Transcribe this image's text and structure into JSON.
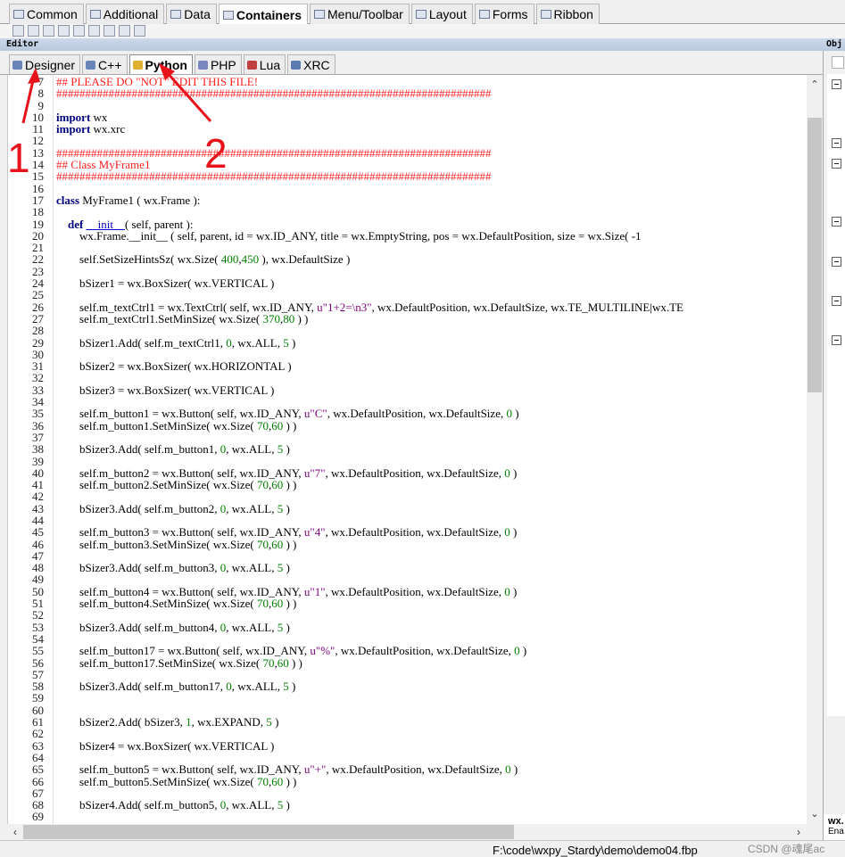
{
  "palette_tabs": [
    {
      "label": "Common",
      "icon": "common-icon",
      "active": false
    },
    {
      "label": "Additional",
      "icon": "additional-icon",
      "active": false
    },
    {
      "label": "Data",
      "icon": "data-icon",
      "active": false
    },
    {
      "label": "Containers",
      "icon": "containers-icon",
      "active": true
    },
    {
      "label": "Menu/Toolbar",
      "icon": "menu-toolbar-icon",
      "active": false
    },
    {
      "label": "Layout",
      "icon": "layout-icon",
      "active": false
    },
    {
      "label": "Forms",
      "icon": "forms-icon",
      "active": false
    },
    {
      "label": "Ribbon",
      "icon": "ribbon-icon",
      "active": false
    }
  ],
  "editor": {
    "title": "Editor",
    "tabs": [
      {
        "label": "Designer",
        "icon": "designer-icon",
        "active": false,
        "color": "#6a86b8"
      },
      {
        "label": "C++",
        "icon": "cpp-icon",
        "active": false,
        "color": "#6a86b8"
      },
      {
        "label": "Python",
        "icon": "python-icon",
        "active": true,
        "color": "#e0b030"
      },
      {
        "label": "PHP",
        "icon": "php-icon",
        "active": false,
        "color": "#7a86c0"
      },
      {
        "label": "Lua",
        "icon": "lua-icon",
        "active": false,
        "color": "#c04040"
      },
      {
        "label": "XRC",
        "icon": "xrc-icon",
        "active": false,
        "color": "#5a7ab0"
      }
    ]
  },
  "object_panel": {
    "title": "Obj",
    "bottom_title": "wx.",
    "bottom_sub": "Ena"
  },
  "code": [
    {
      "n": "7",
      "t": [
        [
          "cm",
          "## PLEASE DO \"NOT\" EDIT THIS FILE!"
        ]
      ]
    },
    {
      "n": "8",
      "t": [
        [
          "cm",
          "###########################################################################"
        ]
      ]
    },
    {
      "n": "9",
      "t": []
    },
    {
      "n": "10",
      "t": [
        [
          "kw",
          "import"
        ],
        [
          "",
          " wx"
        ]
      ]
    },
    {
      "n": "11",
      "t": [
        [
          "kw",
          "import"
        ],
        [
          "",
          " wx.xrc"
        ]
      ]
    },
    {
      "n": "12",
      "t": []
    },
    {
      "n": "13",
      "t": [
        [
          "cm",
          "###########################################################################"
        ]
      ]
    },
    {
      "n": "14",
      "t": [
        [
          "cm",
          "## Class MyFrame1"
        ]
      ]
    },
    {
      "n": "15",
      "t": [
        [
          "cm",
          "###########################################################################"
        ]
      ]
    },
    {
      "n": "16",
      "t": []
    },
    {
      "n": "17",
      "t": [
        [
          "kw",
          "class"
        ],
        [
          "",
          " MyFrame1 ( wx.Frame ):"
        ]
      ]
    },
    {
      "n": "18",
      "t": []
    },
    {
      "n": "19",
      "t": [
        [
          "",
          "    "
        ],
        [
          "kw",
          "def"
        ],
        [
          "",
          " "
        ],
        [
          "df",
          "__init__"
        ],
        [
          "",
          "( self, parent ):"
        ]
      ]
    },
    {
      "n": "20",
      "t": [
        [
          "",
          "        wx.Frame.__init__ ( self, parent, id = wx.ID_ANY, title = wx.EmptyString, pos = wx.DefaultPosition, size = wx.Size( -1"
        ]
      ]
    },
    {
      "n": "21",
      "t": []
    },
    {
      "n": "22",
      "t": [
        [
          "",
          "        self.SetSizeHintsSz( wx.Size( "
        ],
        [
          "nm",
          "400"
        ],
        [
          "",
          ","
        ],
        [
          "nm",
          "450"
        ],
        [
          "",
          " ), wx.DefaultSize )"
        ]
      ]
    },
    {
      "n": "23",
      "t": []
    },
    {
      "n": "24",
      "t": [
        [
          "",
          "        bSizer1 = wx.BoxSizer( wx.VERTICAL )"
        ]
      ]
    },
    {
      "n": "25",
      "t": []
    },
    {
      "n": "26",
      "t": [
        [
          "",
          "        self.m_textCtrl1 = wx.TextCtrl( self, wx.ID_ANY, "
        ],
        [
          "st",
          "u\"1+2=\\n3\""
        ],
        [
          "",
          ", wx.DefaultPosition, wx.DefaultSize, wx.TE_MULTILINE|wx.TE"
        ]
      ]
    },
    {
      "n": "27",
      "t": [
        [
          "",
          "        self.m_textCtrl1.SetMinSize( wx.Size( "
        ],
        [
          "nm",
          "370"
        ],
        [
          "",
          ","
        ],
        [
          "nm",
          "80"
        ],
        [
          "",
          " ) )"
        ]
      ]
    },
    {
      "n": "28",
      "t": []
    },
    {
      "n": "29",
      "t": [
        [
          "",
          "        bSizer1.Add( self.m_textCtrl1, "
        ],
        [
          "nm",
          "0"
        ],
        [
          "",
          ", wx.ALL, "
        ],
        [
          "nm",
          "5"
        ],
        [
          "",
          " )"
        ]
      ]
    },
    {
      "n": "30",
      "t": []
    },
    {
      "n": "31",
      "t": [
        [
          "",
          "        bSizer2 = wx.BoxSizer( wx.HORIZONTAL )"
        ]
      ]
    },
    {
      "n": "32",
      "t": []
    },
    {
      "n": "33",
      "t": [
        [
          "",
          "        bSizer3 = wx.BoxSizer( wx.VERTICAL )"
        ]
      ]
    },
    {
      "n": "34",
      "t": []
    },
    {
      "n": "35",
      "t": [
        [
          "",
          "        self.m_button1 = wx.Button( self, wx.ID_ANY, "
        ],
        [
          "st",
          "u\"C\""
        ],
        [
          "",
          ", wx.DefaultPosition, wx.DefaultSize, "
        ],
        [
          "nm",
          "0"
        ],
        [
          "",
          " )"
        ]
      ]
    },
    {
      "n": "36",
      "t": [
        [
          "",
          "        self.m_button1.SetMinSize( wx.Size( "
        ],
        [
          "nm",
          "70"
        ],
        [
          "",
          ","
        ],
        [
          "nm",
          "60"
        ],
        [
          "",
          " ) )"
        ]
      ]
    },
    {
      "n": "37",
      "t": []
    },
    {
      "n": "38",
      "t": [
        [
          "",
          "        bSizer3.Add( self.m_button1, "
        ],
        [
          "nm",
          "0"
        ],
        [
          "",
          ", wx.ALL, "
        ],
        [
          "nm",
          "5"
        ],
        [
          "",
          " )"
        ]
      ]
    },
    {
      "n": "39",
      "t": []
    },
    {
      "n": "40",
      "t": [
        [
          "",
          "        self.m_button2 = wx.Button( self, wx.ID_ANY, "
        ],
        [
          "st",
          "u\"7\""
        ],
        [
          "",
          ", wx.DefaultPosition, wx.DefaultSize, "
        ],
        [
          "nm",
          "0"
        ],
        [
          "",
          " )"
        ]
      ]
    },
    {
      "n": "41",
      "t": [
        [
          "",
          "        self.m_button2.SetMinSize( wx.Size( "
        ],
        [
          "nm",
          "70"
        ],
        [
          "",
          ","
        ],
        [
          "nm",
          "60"
        ],
        [
          "",
          " ) )"
        ]
      ]
    },
    {
      "n": "42",
      "t": []
    },
    {
      "n": "43",
      "t": [
        [
          "",
          "        bSizer3.Add( self.m_button2, "
        ],
        [
          "nm",
          "0"
        ],
        [
          "",
          ", wx.ALL, "
        ],
        [
          "nm",
          "5"
        ],
        [
          "",
          " )"
        ]
      ]
    },
    {
      "n": "44",
      "t": []
    },
    {
      "n": "45",
      "t": [
        [
          "",
          "        self.m_button3 = wx.Button( self, wx.ID_ANY, "
        ],
        [
          "st",
          "u\"4\""
        ],
        [
          "",
          ", wx.DefaultPosition, wx.DefaultSize, "
        ],
        [
          "nm",
          "0"
        ],
        [
          "",
          " )"
        ]
      ]
    },
    {
      "n": "46",
      "t": [
        [
          "",
          "        self.m_button3.SetMinSize( wx.Size( "
        ],
        [
          "nm",
          "70"
        ],
        [
          "",
          ","
        ],
        [
          "nm",
          "60"
        ],
        [
          "",
          " ) )"
        ]
      ]
    },
    {
      "n": "47",
      "t": []
    },
    {
      "n": "48",
      "t": [
        [
          "",
          "        bSizer3.Add( self.m_button3, "
        ],
        [
          "nm",
          "0"
        ],
        [
          "",
          ", wx.ALL, "
        ],
        [
          "nm",
          "5"
        ],
        [
          "",
          " )"
        ]
      ]
    },
    {
      "n": "49",
      "t": []
    },
    {
      "n": "50",
      "t": [
        [
          "",
          "        self.m_button4 = wx.Button( self, wx.ID_ANY, "
        ],
        [
          "st",
          "u\"1\""
        ],
        [
          "",
          ", wx.DefaultPosition, wx.DefaultSize, "
        ],
        [
          "nm",
          "0"
        ],
        [
          "",
          " )"
        ]
      ]
    },
    {
      "n": "51",
      "t": [
        [
          "",
          "        self.m_button4.SetMinSize( wx.Size( "
        ],
        [
          "nm",
          "70"
        ],
        [
          "",
          ","
        ],
        [
          "nm",
          "60"
        ],
        [
          "",
          " ) )"
        ]
      ]
    },
    {
      "n": "52",
      "t": []
    },
    {
      "n": "53",
      "t": [
        [
          "",
          "        bSizer3.Add( self.m_button4, "
        ],
        [
          "nm",
          "0"
        ],
        [
          "",
          ", wx.ALL, "
        ],
        [
          "nm",
          "5"
        ],
        [
          "",
          " )"
        ]
      ]
    },
    {
      "n": "54",
      "t": []
    },
    {
      "n": "55",
      "t": [
        [
          "",
          "        self.m_button17 = wx.Button( self, wx.ID_ANY, "
        ],
        [
          "st",
          "u\"%\""
        ],
        [
          "",
          ", wx.DefaultPosition, wx.DefaultSize, "
        ],
        [
          "nm",
          "0"
        ],
        [
          "",
          " )"
        ]
      ]
    },
    {
      "n": "56",
      "t": [
        [
          "",
          "        self.m_button17.SetMinSize( wx.Size( "
        ],
        [
          "nm",
          "70"
        ],
        [
          "",
          ","
        ],
        [
          "nm",
          "60"
        ],
        [
          "",
          " ) )"
        ]
      ]
    },
    {
      "n": "57",
      "t": []
    },
    {
      "n": "58",
      "t": [
        [
          "",
          "        bSizer3.Add( self.m_button17, "
        ],
        [
          "nm",
          "0"
        ],
        [
          "",
          ", wx.ALL, "
        ],
        [
          "nm",
          "5"
        ],
        [
          "",
          " )"
        ]
      ]
    },
    {
      "n": "59",
      "t": []
    },
    {
      "n": "60",
      "t": []
    },
    {
      "n": "61",
      "t": [
        [
          "",
          "        bSizer2.Add( bSizer3, "
        ],
        [
          "nm",
          "1"
        ],
        [
          "",
          ", wx.EXPAND, "
        ],
        [
          "nm",
          "5"
        ],
        [
          "",
          " )"
        ]
      ]
    },
    {
      "n": "62",
      "t": []
    },
    {
      "n": "63",
      "t": [
        [
          "",
          "        bSizer4 = wx.BoxSizer( wx.VERTICAL )"
        ]
      ]
    },
    {
      "n": "64",
      "t": []
    },
    {
      "n": "65",
      "t": [
        [
          "",
          "        self.m_button5 = wx.Button( self, wx.ID_ANY, "
        ],
        [
          "st",
          "u\"+\""
        ],
        [
          "",
          ", wx.DefaultPosition, wx.DefaultSize, "
        ],
        [
          "nm",
          "0"
        ],
        [
          "",
          " )"
        ]
      ]
    },
    {
      "n": "66",
      "t": [
        [
          "",
          "        self.m_button5.SetMinSize( wx.Size( "
        ],
        [
          "nm",
          "70"
        ],
        [
          "",
          ","
        ],
        [
          "nm",
          "60"
        ],
        [
          "",
          " ) )"
        ]
      ]
    },
    {
      "n": "67",
      "t": []
    },
    {
      "n": "68",
      "t": [
        [
          "",
          "        bSizer4.Add( self.m_button5, "
        ],
        [
          "nm",
          "0"
        ],
        [
          "",
          ", wx.ALL, "
        ],
        [
          "nm",
          "5"
        ],
        [
          "",
          " )"
        ]
      ]
    },
    {
      "n": "69",
      "t": []
    }
  ],
  "status": {
    "path": "F:\\code\\wxpy_Stardy\\demo\\demo04.fbp",
    "watermark": "CSDN @魂尾ac"
  },
  "annotations": [
    {
      "label": "1",
      "color": "#e8121b"
    },
    {
      "label": "2",
      "color": "#e8121b"
    }
  ]
}
